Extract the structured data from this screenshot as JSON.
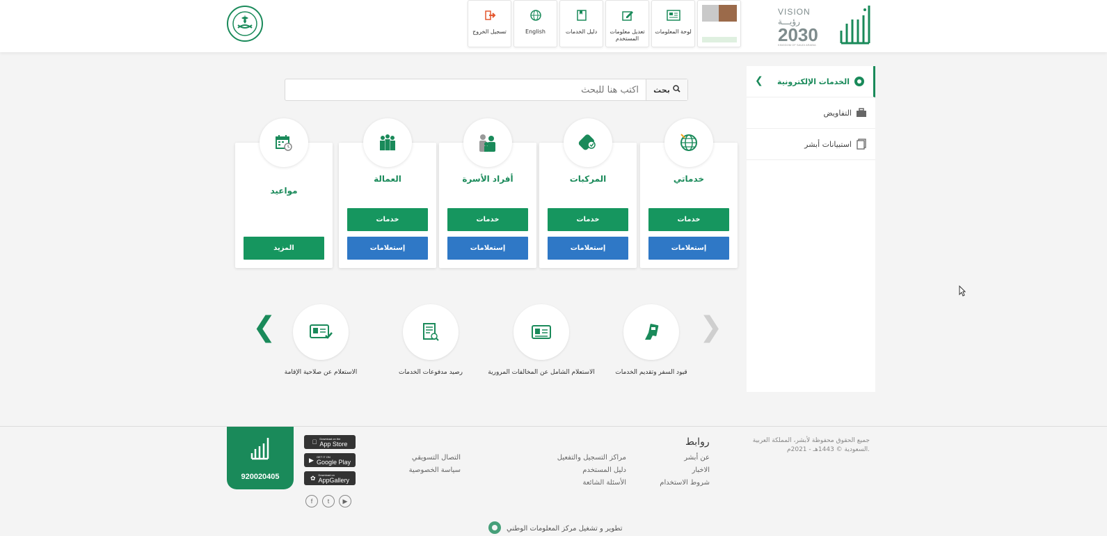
{
  "header": {
    "toolbar": [
      {
        "label": "لوحة المعلومات",
        "icon": "dashboard-icon"
      },
      {
        "label": "تعديل معلومات المستخدم",
        "icon": "edit-icon"
      },
      {
        "label": "دليل الخدمات",
        "icon": "book-icon"
      },
      {
        "label": "English",
        "icon": "globe-icon"
      },
      {
        "label": "تسجيل الخروج",
        "icon": "logout-icon"
      }
    ],
    "vision": {
      "line1": "VISION رؤيـــة",
      "line2": "2030",
      "line3": "KINGDOM OF SAUDI ARABIA"
    }
  },
  "sidebar": {
    "items": [
      {
        "label": "الخدمات الإلكترونية",
        "icon": "eservices-icon"
      },
      {
        "label": "التفاويض",
        "icon": "briefcase-icon"
      },
      {
        "label": "استبيانات أبشر",
        "icon": "survey-icon"
      }
    ]
  },
  "search": {
    "button_label": "بحث",
    "placeholder": "اكتب هنا للبحث"
  },
  "cards": [
    {
      "title": "خدماتي",
      "btn1": "خدمات",
      "btn2": "إستعلامات",
      "icon": "globe-icon"
    },
    {
      "title": "المركبات",
      "btn1": "خدمات",
      "btn2": "إستعلامات",
      "icon": "car-icon"
    },
    {
      "title": "أفراد الأسرة",
      "btn1": "خدمات",
      "btn2": "إستعلامات",
      "icon": "family-icon"
    },
    {
      "title": "العمالة",
      "btn1": "خدمات",
      "btn2": "إستعلامات",
      "icon": "workers-icon"
    },
    {
      "title": "مواعيد",
      "btn1": "المزيد",
      "icon": "calendar-icon"
    }
  ],
  "carousel": [
    {
      "label": "قيود السفر وتقديم الخدمات",
      "icon": "travel-card-icon"
    },
    {
      "label": "الاستعلام الشامل عن المخالفات المرورية",
      "icon": "id-card-icon"
    },
    {
      "label": "رصيد مدفوعات الخدمات",
      "icon": "receipt-icon"
    },
    {
      "label": "الاستعلام عن صلاحية الإقامة",
      "icon": "residency-check-icon"
    }
  ],
  "footer": {
    "copyright": "جميع الحقوق محفوظة لأبشر، المملكة العربية السعودية © 1443هـ - 2021م.",
    "links_title": "روابط",
    "links_col1": [
      "عن أبشر",
      "الاخبار",
      "شروط الاستخدام"
    ],
    "links_col2": [
      "مراكز التسجيل والتفعيل",
      "دليل المستخدم",
      "الأسئلة الشائعة"
    ],
    "links_col3": [
      "التصال التسويقي",
      "سياسة الخصوصية"
    ],
    "stores": [
      {
        "small": "Download on the",
        "name": "App Store"
      },
      {
        "small": "GET IT ON",
        "name": "Google Play"
      },
      {
        "small": "Download on",
        "name": "AppGallery"
      }
    ],
    "phone": "920020405",
    "credit": "تطوير و تشغيل مركز المعلومات الوطني"
  },
  "colors": {
    "primary_green": "#16965f",
    "blue": "#2f78c6"
  }
}
